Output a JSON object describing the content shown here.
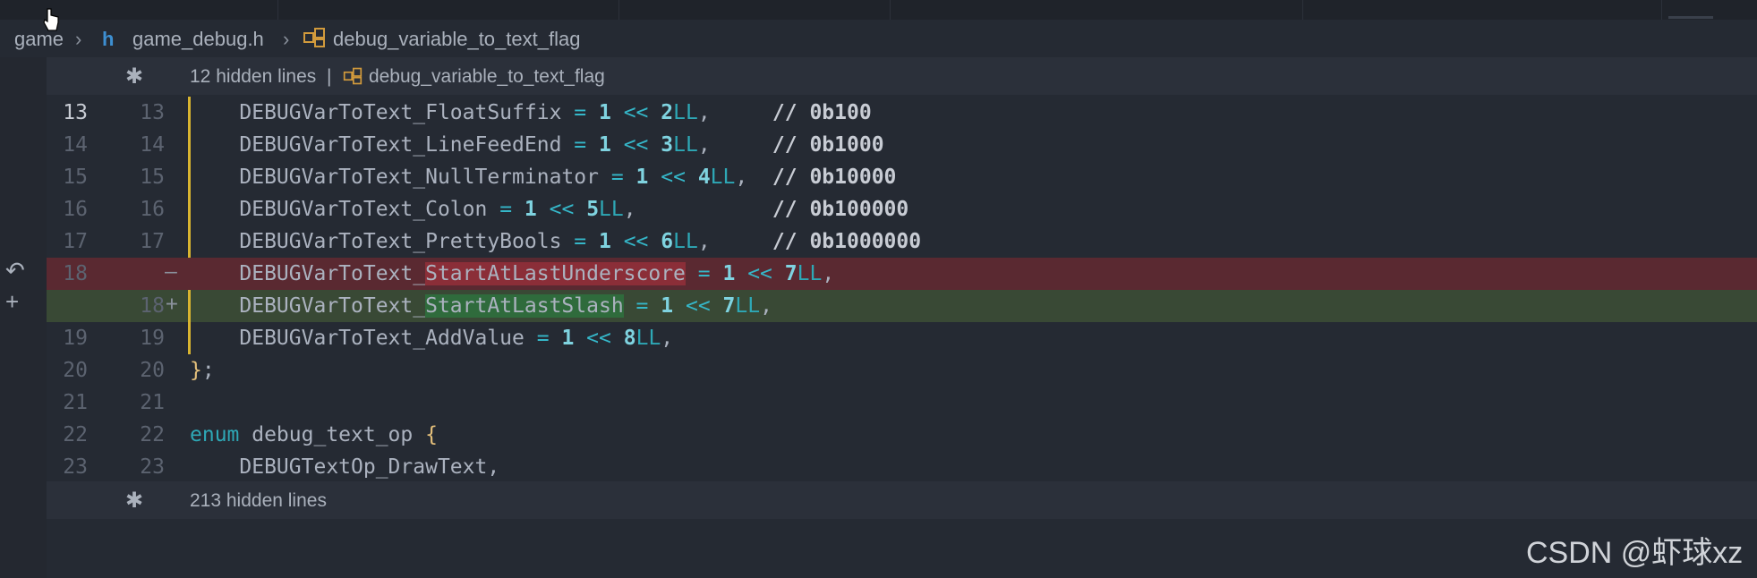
{
  "breadcrumb": {
    "root": "game",
    "file": "game_debug.h",
    "symbol": "debug_variable_to_text_flag",
    "file_icon": "h",
    "file_icon_name": "c-header-file-icon",
    "symbol_icon_name": "struct-icon"
  },
  "fold_top": {
    "text": "12 hidden lines",
    "sep": "|",
    "symbol": "debug_variable_to_text_flag"
  },
  "fold_bottom": {
    "text": "213 hidden lines"
  },
  "lines": [
    {
      "old": "13",
      "new": "13",
      "kind": "ctx",
      "text": "    DEBUGVarToText_FloatSuffix = 1 << 2LL,     // 0b100"
    },
    {
      "old": "14",
      "new": "14",
      "kind": "ctx",
      "text": "    DEBUGVarToText_LineFeedEnd = 1 << 3LL,     // 0b1000"
    },
    {
      "old": "15",
      "new": "15",
      "kind": "ctx",
      "text": "    DEBUGVarToText_NullTerminator = 1 << 4LL,  // 0b10000"
    },
    {
      "old": "16",
      "new": "16",
      "kind": "ctx",
      "text": "    DEBUGVarToText_Colon = 1 << 5LL,           // 0b100000"
    },
    {
      "old": "17",
      "new": "17",
      "kind": "ctx",
      "text": "    DEBUGVarToText_PrettyBools = 1 << 6LL,     // 0b1000000"
    },
    {
      "old": "18",
      "new": "",
      "kind": "del",
      "marker": "—",
      "text": "    DEBUGVarToText_StartAtLastUnderscore = 1 << 7LL,"
    },
    {
      "old": "",
      "new": "18",
      "kind": "add",
      "marker": "+",
      "text": "    DEBUGVarToText_StartAtLastSlash = 1 << 7LL,"
    },
    {
      "old": "19",
      "new": "19",
      "kind": "ctx",
      "text": "    DEBUGVarToText_AddValue = 1 << 8LL,"
    },
    {
      "old": "20",
      "new": "20",
      "kind": "ctx",
      "text": "};"
    },
    {
      "old": "21",
      "new": "21",
      "kind": "ctx",
      "text": ""
    },
    {
      "old": "22",
      "new": "22",
      "kind": "ctx",
      "text": "enum debug_text_op {"
    },
    {
      "old": "23",
      "new": "23",
      "kind": "ctx",
      "text": "    DEBUGTextOp_DrawText,"
    }
  ],
  "watermark": "CSDN @虾球xz",
  "colors": {
    "background": "#252a33",
    "deleted": "#5a2931",
    "added": "#394935",
    "modified_bar": "#d8b430"
  }
}
